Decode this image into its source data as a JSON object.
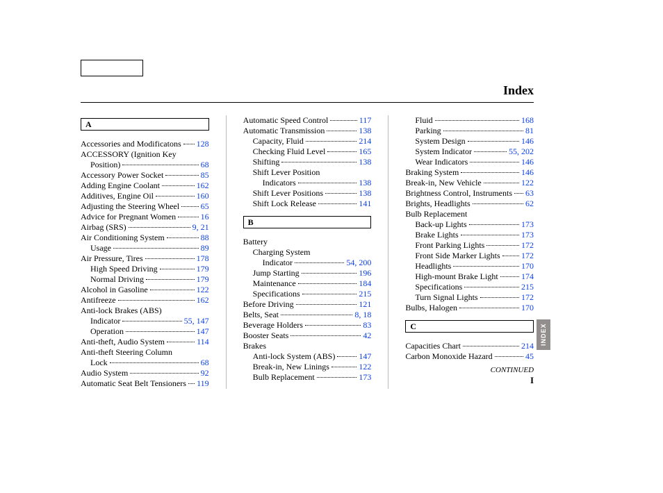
{
  "title": "Index",
  "sidetab": "INDEX",
  "continued": "CONTINUED",
  "roman": "I",
  "columns": [
    {
      "items": [
        {
          "type": "letter",
          "text": "A"
        },
        {
          "type": "spacer"
        },
        {
          "type": "entry",
          "label": "Accessories and Modificatons",
          "page": "128"
        },
        {
          "type": "entry",
          "label": "ACCESSORY (Ignition Key",
          "noleader": true
        },
        {
          "type": "entry",
          "indent": 1,
          "label": "Position)",
          "page": "68"
        },
        {
          "type": "entry",
          "label": "Accessory Power Socket",
          "page": "85"
        },
        {
          "type": "entry",
          "label": "Adding Engine Coolant",
          "page": "162"
        },
        {
          "type": "entry",
          "label": "Additives, Engine Oil",
          "page": "160"
        },
        {
          "type": "entry",
          "label": "Adjusting the Steering Wheel",
          "page": "65"
        },
        {
          "type": "entry",
          "label": "Advice for Pregnant Women",
          "page": "16"
        },
        {
          "type": "entry",
          "label": "Airbag (SRS)",
          "page": "9, 21"
        },
        {
          "type": "entry",
          "label": "Air Conditioning System",
          "page": "88"
        },
        {
          "type": "entry",
          "indent": 1,
          "label": "Usage",
          "page": "89"
        },
        {
          "type": "entry",
          "label": "Air Pressure, Tires",
          "page": "178"
        },
        {
          "type": "entry",
          "indent": 1,
          "label": "High Speed Driving",
          "page": "179"
        },
        {
          "type": "entry",
          "indent": 1,
          "label": "Normal Driving",
          "page": "179"
        },
        {
          "type": "entry",
          "label": "Alcohol in Gasoline",
          "page": "122"
        },
        {
          "type": "entry",
          "label": "Antifreeze",
          "page": "162"
        },
        {
          "type": "entry",
          "label": "Anti-lock Brakes (ABS)",
          "noleader": true
        },
        {
          "type": "entry",
          "indent": 1,
          "label": "Indicator",
          "page": "55, 147"
        },
        {
          "type": "entry",
          "indent": 1,
          "label": "Operation",
          "page": "147"
        },
        {
          "type": "entry",
          "label": "Anti-theft, Audio System",
          "page": "114"
        },
        {
          "type": "entry",
          "label": "Anti-theft Steering Column",
          "noleader": true
        },
        {
          "type": "entry",
          "indent": 1,
          "label": "Lock",
          "page": "68"
        },
        {
          "type": "entry",
          "label": "Audio System",
          "page": "92"
        },
        {
          "type": "entry",
          "label": "Automatic Seat Belt Tensioners",
          "page": "119"
        }
      ]
    },
    {
      "items": [
        {
          "type": "entry",
          "label": "Automatic Speed Control",
          "page": "117"
        },
        {
          "type": "entry",
          "label": "Automatic Transmission",
          "page": "138"
        },
        {
          "type": "entry",
          "indent": 1,
          "label": "Capacity, Fluid",
          "page": "214"
        },
        {
          "type": "entry",
          "indent": 1,
          "label": "Checking Fluid Level",
          "page": "165"
        },
        {
          "type": "entry",
          "indent": 1,
          "label": "Shifting",
          "page": "138"
        },
        {
          "type": "entry",
          "indent": 1,
          "label": "Shift Lever Position",
          "noleader": true
        },
        {
          "type": "entry",
          "indent": 2,
          "label": "Indicators",
          "page": "138"
        },
        {
          "type": "entry",
          "indent": 1,
          "label": "Shift Lever Positions",
          "page": "138"
        },
        {
          "type": "entry",
          "indent": 1,
          "label": "Shift Lock Release",
          "page": "141"
        },
        {
          "type": "spacer"
        },
        {
          "type": "letter",
          "text": "B"
        },
        {
          "type": "spacer"
        },
        {
          "type": "entry",
          "label": "Battery",
          "noleader": true
        },
        {
          "type": "entry",
          "indent": 1,
          "label": "Charging System",
          "noleader": true
        },
        {
          "type": "entry",
          "indent": 2,
          "label": "Indicator",
          "page": "54, 200"
        },
        {
          "type": "entry",
          "indent": 1,
          "label": "Jump Starting",
          "page": "196"
        },
        {
          "type": "entry",
          "indent": 1,
          "label": "Maintenance",
          "page": "184"
        },
        {
          "type": "entry",
          "indent": 1,
          "label": "Specifications",
          "page": "215"
        },
        {
          "type": "entry",
          "label": "Before Driving",
          "page": "121"
        },
        {
          "type": "entry",
          "label": "Belts, Seat",
          "page": "8, 18"
        },
        {
          "type": "entry",
          "label": "Beverage Holders",
          "page": "83"
        },
        {
          "type": "entry",
          "label": "Booster Seats",
          "page": "42"
        },
        {
          "type": "entry",
          "label": "Brakes",
          "noleader": true
        },
        {
          "type": "entry",
          "indent": 1,
          "label": "Anti-lock System (ABS)",
          "page": "147"
        },
        {
          "type": "entry",
          "indent": 1,
          "label": "Break-in, New Linings",
          "page": "122"
        },
        {
          "type": "entry",
          "indent": 1,
          "label": "Bulb Replacement",
          "page": "173"
        }
      ]
    },
    {
      "items": [
        {
          "type": "entry",
          "indent": 1,
          "label": "Fluid",
          "page": "168"
        },
        {
          "type": "entry",
          "indent": 1,
          "label": "Parking",
          "page": "81"
        },
        {
          "type": "entry",
          "indent": 1,
          "label": "System Design",
          "page": "146"
        },
        {
          "type": "entry",
          "indent": 1,
          "label": "System Indicator",
          "page": "55, 202"
        },
        {
          "type": "entry",
          "indent": 1,
          "label": "Wear Indicators",
          "page": "146"
        },
        {
          "type": "entry",
          "label": "Braking System",
          "page": "146"
        },
        {
          "type": "entry",
          "label": "Break-in, New Vehicle",
          "page": "122"
        },
        {
          "type": "entry",
          "label": "Brightness Control, Instruments",
          "page": "63"
        },
        {
          "type": "entry",
          "label": "Brights, Headlights",
          "page": "62"
        },
        {
          "type": "entry",
          "label": "Bulb Replacement",
          "noleader": true
        },
        {
          "type": "entry",
          "indent": 1,
          "label": "Back-up Lights",
          "page": "173"
        },
        {
          "type": "entry",
          "indent": 1,
          "label": "Brake Lights",
          "page": "173"
        },
        {
          "type": "entry",
          "indent": 1,
          "label": "Front Parking Lights",
          "page": "172"
        },
        {
          "type": "entry",
          "indent": 1,
          "label": "Front Side Marker Lights",
          "page": "172"
        },
        {
          "type": "entry",
          "indent": 1,
          "label": "Headlights",
          "page": "170"
        },
        {
          "type": "entry",
          "indent": 1,
          "label": "High-mount Brake Light",
          "page": "174"
        },
        {
          "type": "entry",
          "indent": 1,
          "label": "Specifications",
          "page": "215"
        },
        {
          "type": "entry",
          "indent": 1,
          "label": "Turn Signal Lights",
          "page": "172"
        },
        {
          "type": "entry",
          "label": "Bulbs, Halogen",
          "page": "170"
        },
        {
          "type": "spacer"
        },
        {
          "type": "letter",
          "text": "C"
        },
        {
          "type": "spacer"
        },
        {
          "type": "entry",
          "label": "Capacities Chart",
          "page": "214"
        },
        {
          "type": "entry",
          "label": "Carbon Monoxide Hazard",
          "page": "45"
        },
        {
          "type": "continued"
        }
      ]
    }
  ]
}
